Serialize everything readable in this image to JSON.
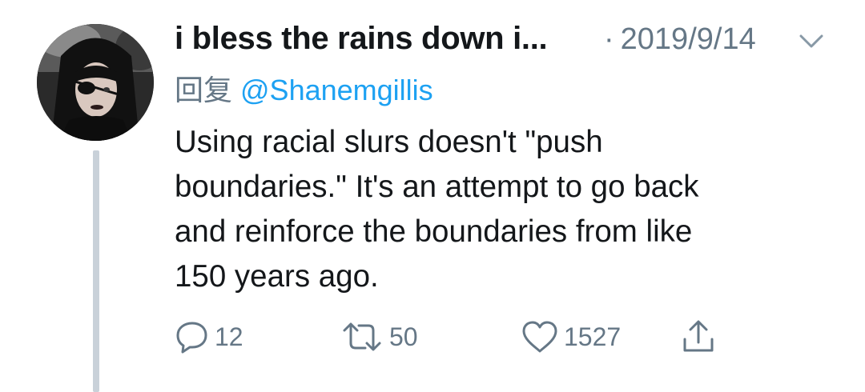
{
  "tweet": {
    "display_name": "i bless the rains down i...",
    "separator": "·",
    "date": "2019/9/14",
    "reply_prefix": "回复",
    "reply_handle": "@Shanemgillis",
    "text": "Using racial slurs doesn't \"push\nboundaries.\" It's an attempt to go back\nand reinforce the boundaries from like\n150 years ago.",
    "actions": {
      "replies": "12",
      "retweets": "50",
      "likes": "1527"
    }
  },
  "icons": {
    "menu": "chevron-down-icon",
    "reply": "reply-bubble-icon",
    "retweet": "retweet-icon",
    "like": "heart-icon",
    "share": "share-icon"
  },
  "colors": {
    "name": "#14171a",
    "secondary": "#657786",
    "link": "#1da1f2",
    "thread_line": "#c9d1d9"
  }
}
